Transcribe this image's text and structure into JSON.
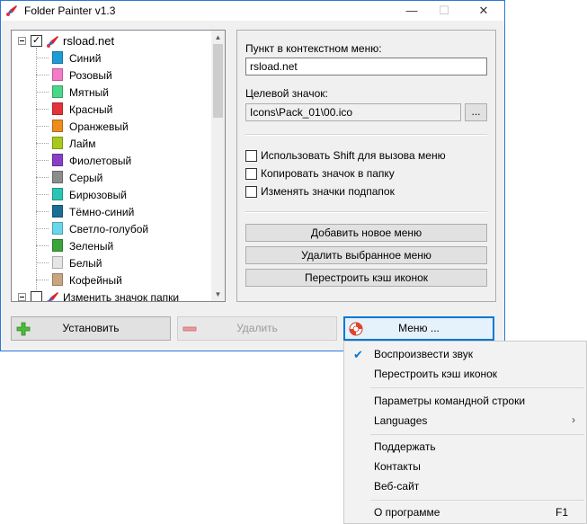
{
  "window": {
    "title": "Folder Painter v1.3",
    "controls": {
      "minimize": "—",
      "maximize": "☐",
      "close": "✕"
    }
  },
  "tree": {
    "root": {
      "label": "rsload.net",
      "checked": true
    },
    "items": [
      {
        "label": "Синий",
        "color": "#1e9bd7"
      },
      {
        "label": "Розовый",
        "color": "#f57ac8"
      },
      {
        "label": "Мятный",
        "color": "#4cd68a"
      },
      {
        "label": "Красный",
        "color": "#e5333c"
      },
      {
        "label": "Оранжевый",
        "color": "#f08c1e"
      },
      {
        "label": "Лайм",
        "color": "#a8c81e"
      },
      {
        "label": "Фиолетовый",
        "color": "#8a3ec8"
      },
      {
        "label": "Серый",
        "color": "#8c8c8c"
      },
      {
        "label": "Бирюзовый",
        "color": "#2cc4b4"
      },
      {
        "label": "Тёмно-синий",
        "color": "#1a6e96"
      },
      {
        "label": "Светло-голубой",
        "color": "#6ad6ec"
      },
      {
        "label": "Зеленый",
        "color": "#3aa63a"
      },
      {
        "label": "Белый",
        "color": "#e6e6e6"
      },
      {
        "label": "Кофейный",
        "color": "#c8a682"
      }
    ],
    "second_root": {
      "label": "Изменить значок папки",
      "checked": false
    }
  },
  "settings": {
    "menu_item_label": "Пункт в контекстном меню:",
    "menu_item_value": "rsload.net",
    "icon_label": "Целевой значок:",
    "icon_value": "Icons\\Pack_01\\00.ico",
    "browse_label": "...",
    "options": [
      {
        "label": "Использовать Shift для вызова меню",
        "checked": false
      },
      {
        "label": "Копировать значок в папку",
        "checked": false
      },
      {
        "label": "Изменять значки подпапок",
        "checked": false
      }
    ],
    "add_menu_label": "Добавить новое меню",
    "delete_menu_label": "Удалить выбранное меню",
    "rebuild_cache_label": "Перестроить кэш иконок"
  },
  "bottom": {
    "install_label": "Установить",
    "remove_label": "Удалить",
    "menu_label": "Меню ..."
  },
  "context_menu": {
    "play_sound": {
      "label": "Воспроизвести звук",
      "checked": true
    },
    "rebuild_cache": "Перестроить кэш иконок",
    "cmd_params": "Параметры командной строки",
    "languages": "Languages",
    "support": "Поддержать",
    "contacts": "Контакты",
    "website": "Веб-сайт",
    "about": "О программе",
    "about_shortcut": "F1"
  },
  "colors": {
    "accent": "#0078d7",
    "window_border": "#2b79d7"
  }
}
